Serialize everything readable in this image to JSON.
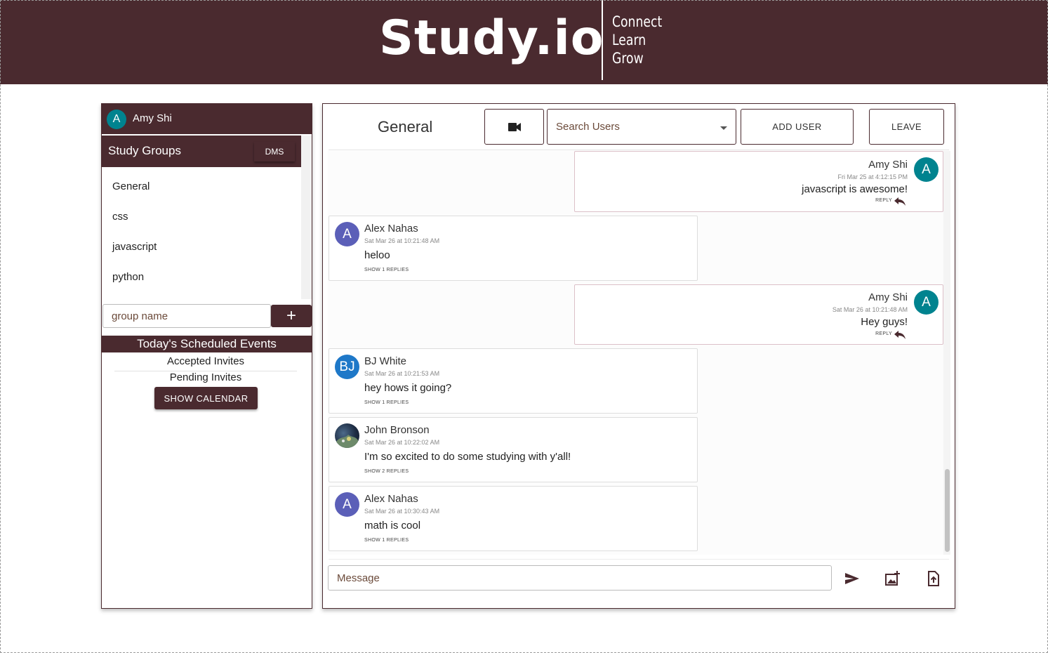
{
  "app": {
    "logo": "Study.io",
    "tagline": [
      "Connect",
      "Learn",
      "Grow"
    ]
  },
  "sidebar": {
    "user": {
      "avatar_letter": "A",
      "name": "Amy Shi"
    },
    "groups_title": "Study Groups",
    "dms_label": "DMS",
    "groups": [
      "General",
      "css",
      "javascript",
      "python"
    ],
    "group_input_placeholder": "group name",
    "add_label": "+",
    "events_title": "Today's Scheduled Events",
    "accepted_label": "Accepted Invites",
    "pending_label": "Pending Invites",
    "calendar_label": "SHOW CALENDAR"
  },
  "chat": {
    "channel": "General",
    "search_label": "Search Users",
    "add_user_label": "ADD USER",
    "leave_label": "LEAVE",
    "message_placeholder": "Message",
    "messages": [
      {
        "author": "Amy Shi",
        "avatar": "A",
        "timestamp": "Fri Mar 25 at 4:12:15 PM",
        "text": "javascript is awesome!",
        "action": "REPLY"
      },
      {
        "author": "Alex Nahas",
        "avatar": "A",
        "timestamp": "Sat Mar 26 at 10:21:48 AM",
        "text": "heloo",
        "action": "SHOW 1 REPLIES"
      },
      {
        "author": "Amy Shi",
        "avatar": "A",
        "timestamp": "Sat Mar 26 at 10:21:48 AM",
        "text": "Hey guys!",
        "action": "REPLY"
      },
      {
        "author": "BJ White",
        "avatar": "BJ",
        "timestamp": "Sat Mar 26 at 10:21:53 AM",
        "text": "hey hows it going?",
        "action": "SHOW 1 REPLIES"
      },
      {
        "author": "John Bronson",
        "avatar": "",
        "timestamp": "Sat Mar 26 at 10:22:02 AM",
        "text": "I'm so excited to do some studying with y'all!",
        "action": "SHOW 2 REPLIES"
      },
      {
        "author": "Alex Nahas",
        "avatar": "A",
        "timestamp": "Sat Mar 26 at 10:30:43 AM",
        "text": "math is cool",
        "action": "SHOW 1 REPLIES"
      }
    ]
  },
  "colors": {
    "brand": "#4a2a2f",
    "avatar_teal": "#00838f",
    "avatar_indigo": "#5b5fb8",
    "avatar_blue": "#1e78c8"
  },
  "icons": [
    "video-camera-icon",
    "caret-down-icon",
    "reply-arrow-icon",
    "send-icon",
    "add-image-icon",
    "upload-file-icon"
  ]
}
